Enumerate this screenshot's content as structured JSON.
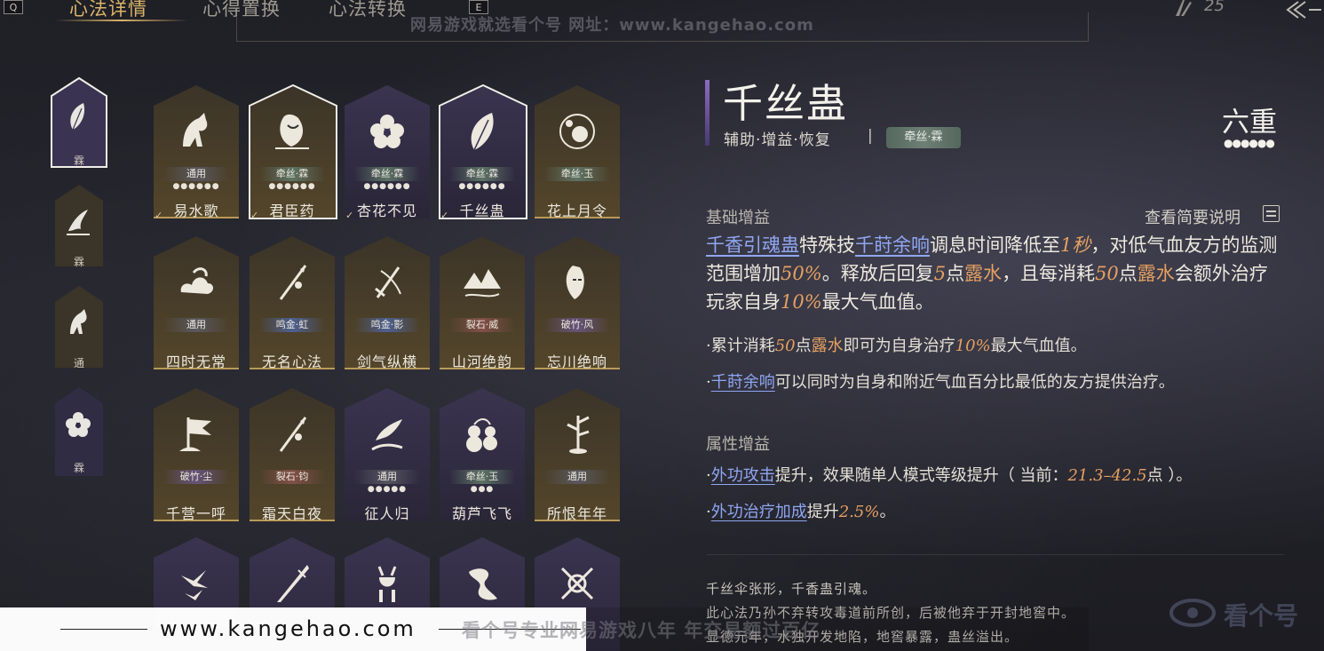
{
  "topbar": {
    "key_left": "Q",
    "key_right": "E",
    "tabs": [
      "心法详情",
      "心得置换",
      "心法转换"
    ],
    "watermark": "网易游戏就选看个号   网址：www.kangehao.com",
    "count": "25"
  },
  "categories": [
    {
      "label": "霖",
      "icon": "leaf-icon"
    },
    {
      "label": "霖",
      "icon": "wave-icon"
    },
    {
      "label": "通",
      "icon": "horse-icon"
    },
    {
      "label": "霖",
      "icon": "flower-icon"
    }
  ],
  "cards": [
    {
      "name": "易水歌",
      "tag": "通用",
      "tag_style": "plain",
      "dots": "●●●●●●",
      "icon": "horse-icon",
      "checked": true,
      "theme": "gold"
    },
    {
      "name": "君臣药",
      "tag": "牵丝·霖",
      "tag_style": "green",
      "dots": "●●●●●●",
      "icon": "jar-icon",
      "checked": true,
      "theme": "gold",
      "selected": true
    },
    {
      "name": "杏花不见",
      "tag": "牵丝·霖",
      "tag_style": "green",
      "dots": "●●●●●●",
      "icon": "flower-icon",
      "checked": true,
      "theme": "purple"
    },
    {
      "name": "千丝蛊",
      "tag": "牵丝·霖",
      "tag_style": "green",
      "dots": "●●●●●●",
      "icon": "leaf-icon",
      "checked": true,
      "theme": "purple",
      "selected": true
    },
    {
      "name": "花上月令",
      "tag": "牵丝·玉",
      "tag_style": "green",
      "dots": "",
      "icon": "moon-flower-icon",
      "checked": false,
      "theme": "gold"
    },
    {
      "name": "四时无常",
      "tag": "通用",
      "tag_style": "plain",
      "dots": "",
      "icon": "cloud-icon",
      "checked": false,
      "theme": "gold"
    },
    {
      "name": "无名心法",
      "tag": "鸣金·虹",
      "tag_style": "blue",
      "dots": "",
      "icon": "spear-icon",
      "checked": false,
      "theme": "gold"
    },
    {
      "name": "剑气纵横",
      "tag": "鸣金·影",
      "tag_style": "blue",
      "dots": "",
      "icon": "sword-icon",
      "checked": false,
      "theme": "gold"
    },
    {
      "name": "山河绝韵",
      "tag": "裂石·威",
      "tag_style": "red",
      "dots": "",
      "icon": "mountain-icon",
      "checked": false,
      "theme": "gold"
    },
    {
      "name": "忘川绝响",
      "tag": "破竹·风",
      "tag_style": "purple",
      "dots": "",
      "icon": "mask-icon",
      "checked": false,
      "theme": "gold"
    },
    {
      "name": "千营一呼",
      "tag": "破竹·尘",
      "tag_style": "purple",
      "dots": "",
      "icon": "banner-icon",
      "checked": false,
      "theme": "gold"
    },
    {
      "name": "霜天白夜",
      "tag": "裂石·钧",
      "tag_style": "red",
      "dots": "",
      "icon": "spear-icon",
      "checked": false,
      "theme": "gold"
    },
    {
      "name": "征人归",
      "tag": "通用",
      "tag_style": "plain",
      "dots": "●●●●●",
      "icon": "bird-hand-icon",
      "checked": false,
      "theme": "purple"
    },
    {
      "name": "葫芦飞飞",
      "tag": "牵丝·玉",
      "tag_style": "green",
      "dots": "●●●",
      "icon": "gourd-icon",
      "checked": false,
      "theme": "purple"
    },
    {
      "name": "所恨年年",
      "tag": "通用",
      "tag_style": "plain",
      "dots": "",
      "icon": "bamboo-icon",
      "checked": false,
      "theme": "gold"
    },
    {
      "name": "",
      "tag": "",
      "tag_style": "plain",
      "dots": "",
      "icon": "swallows-icon",
      "checked": false,
      "theme": "purple"
    },
    {
      "name": "",
      "tag": "",
      "tag_style": "plain",
      "dots": "",
      "icon": "blade-icon",
      "checked": false,
      "theme": "purple"
    },
    {
      "name": "",
      "tag": "",
      "tag_style": "plain",
      "dots": "",
      "icon": "deer-icon",
      "checked": false,
      "theme": "purple"
    },
    {
      "name": "",
      "tag": "",
      "tag_style": "plain",
      "dots": "",
      "icon": "dragon-icon",
      "checked": false,
      "theme": "purple"
    },
    {
      "name": "",
      "tag": "",
      "tag_style": "plain",
      "dots": "",
      "icon": "knot-icon",
      "checked": false,
      "theme": "purple"
    }
  ],
  "detail": {
    "title": "千丝蛊",
    "subtitle": "辅助·增益·恢复",
    "separator": "|",
    "school": "牵丝·霖",
    "rank": "六重",
    "rank_dots": "●●●●●●",
    "base_header": "基础增益",
    "view_brief": "查看简要说明",
    "main": {
      "s1": "千香引魂蛊",
      "s2": "特殊技",
      "s3": "千莳余响",
      "s4": "调息时间降低至",
      "s5": "1秒",
      "s6": "，对低气血友方的监测范围增加",
      "s7": "50%",
      "s8": "。释放后回复",
      "s9": "5",
      "s10": "点",
      "s11": "露水",
      "s12": "，且每消耗",
      "s13": "50",
      "s14": "点",
      "s15": "露水",
      "s16": "会额外治疗玩家自身",
      "s17": "10%",
      "s18": "最大气血值。"
    },
    "b1": {
      "p": "·累计消耗",
      "n": "50",
      "u": "点",
      "k": "露水",
      "m": "即可为自身治疗",
      "v": "10%",
      "e": "最大气血值。"
    },
    "b2": {
      "p": "·",
      "k": "千莳余响",
      "e": "可以同时为自身和附近气血百分比最低的友方提供治疗。"
    },
    "attr_header": "属性增益",
    "b3": {
      "p": "·",
      "k": "外功攻击",
      "m": "提升，效果随单人模式等级提升（ 当前：",
      "v": "21.3–42.5",
      "e": "点 ）。"
    },
    "b4": {
      "p": "·",
      "k": "外功治疗加成",
      "m": "提升",
      "v": "2.5%",
      "e": "。"
    },
    "lore": [
      "千丝伞张形，千香蛊引魂。",
      "此心法乃孙不弃转攻毒道前所创，后被他弃于开封地窖中。",
      "显德元年，水独开发地陷，地窖暴露，蛊丝溢出。"
    ]
  },
  "watermarks": {
    "url": "www.kangehao.com",
    "slogan": "看个号专业网易游戏八年     年交易额过百亿",
    "logo": "看个号"
  },
  "colors": {
    "gold_accent": "#d9b46a",
    "link_blue": "#8fa6f2",
    "highlight_orange": "#e5a062",
    "school_green": "#6e8074"
  }
}
